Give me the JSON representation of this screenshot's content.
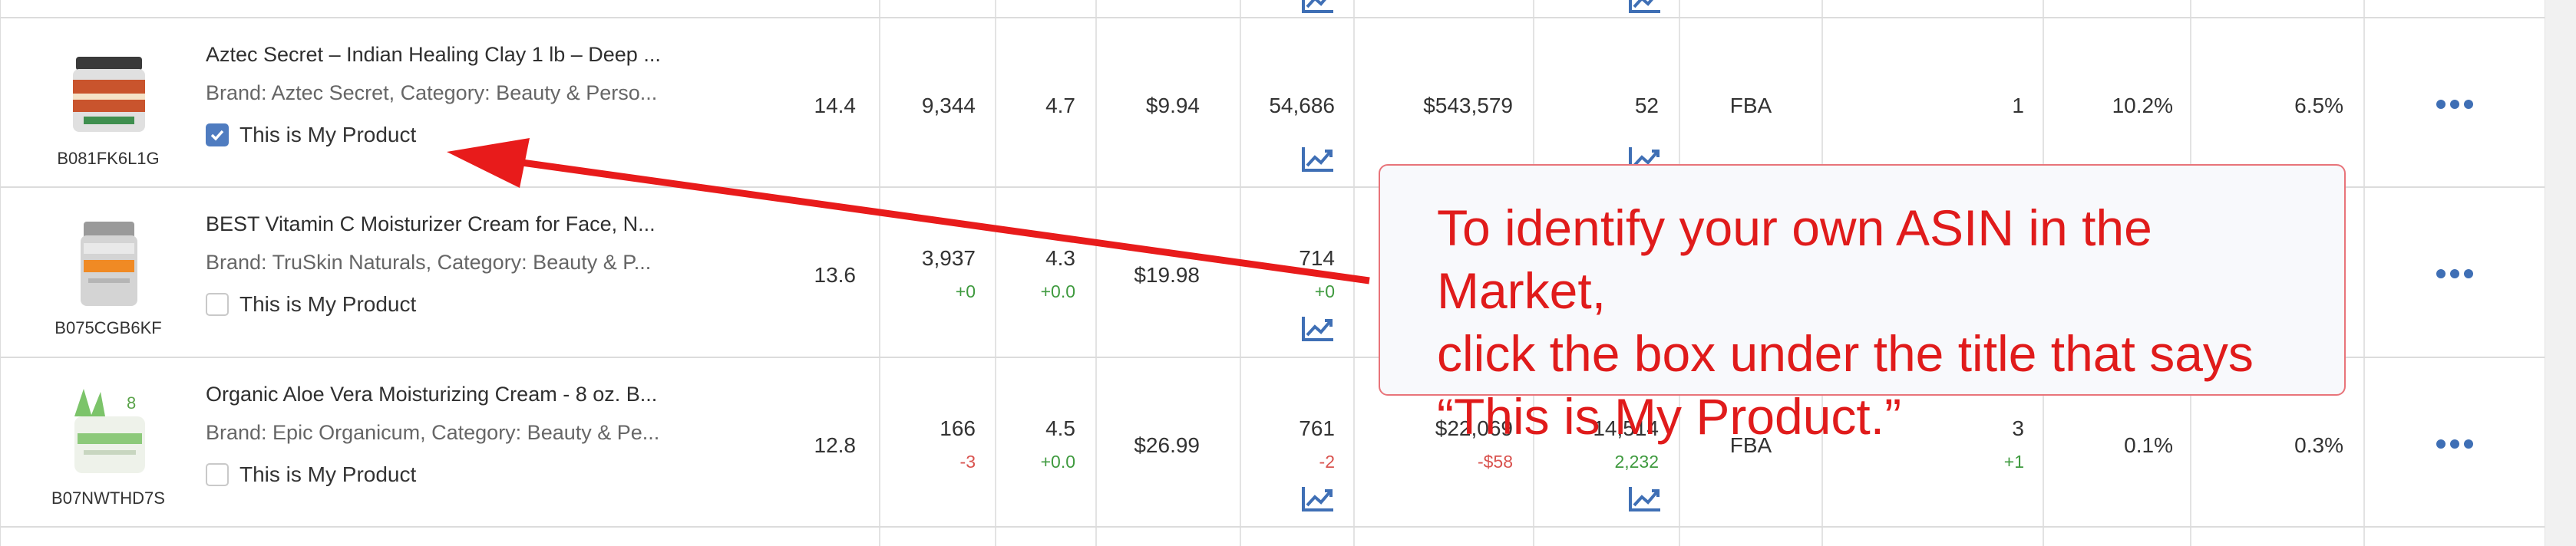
{
  "rows": [
    {
      "asin": "B081FK6L1G",
      "title": "Aztec Secret – Indian Healing Clay 1 lb – Deep ...",
      "brand_line": "Brand: Aztec Secret,   Category: Beauty & Perso...",
      "this_is_my_product": "This is My Product",
      "checked": true,
      "col1": "14.4",
      "col2": "9,344",
      "col3": "4.7",
      "col4": "$9.94",
      "col5": "54,686",
      "col6": "$543,579",
      "col7": "52",
      "col8": "FBA",
      "col9": "1",
      "col10": "10.2%",
      "col11": "6.5%"
    },
    {
      "asin": "B075CGB6KF",
      "title": "BEST Vitamin C Moisturizer Cream for Face, N...",
      "brand_line": "Brand: TruSkin Naturals,   Category: Beauty & P...",
      "this_is_my_product": "This is My Product",
      "checked": false,
      "col1": "13.6",
      "col2": "3,937",
      "col2_delta": "+0",
      "col3": "4.3",
      "col3_delta": "+0.0",
      "col4": "$19.98",
      "col5": "714",
      "col5_delta": "+0"
    },
    {
      "asin": "B07NWTHD7S",
      "title": "Organic Aloe Vera Moisturizing Cream - 8 oz. B...",
      "brand_line": "Brand: Epic Organicum,   Category: Beauty & Pe...",
      "this_is_my_product": "This is My Product",
      "checked": false,
      "col1": "12.8",
      "col2": "166",
      "col2_delta": "-3",
      "col3": "4.5",
      "col3_delta": "+0.0",
      "col4": "$26.99",
      "col5": "761",
      "col5_delta": "-2",
      "col6": "$22,069",
      "col6_delta": "-$58",
      "col7": "14,514",
      "col7_delta": "2,232",
      "col8": "FBA",
      "col9": "3",
      "col9_delta": "+1",
      "col10": "0.1%",
      "col11": "0.3%"
    }
  ],
  "callout": {
    "line1": "To identify your own ASIN in the Market,",
    "line2": "click the box under the title that says",
    "line3": "“This is My Product.”"
  },
  "colors": {
    "accent_blue": "#4f7cc0",
    "positive_green": "#3f9a3f",
    "negative_red": "#d9534f",
    "annotation_red": "#e01b1b"
  },
  "icons": [
    "trend-chart-icon",
    "more-options-icon",
    "checkbox-checked-icon"
  ]
}
